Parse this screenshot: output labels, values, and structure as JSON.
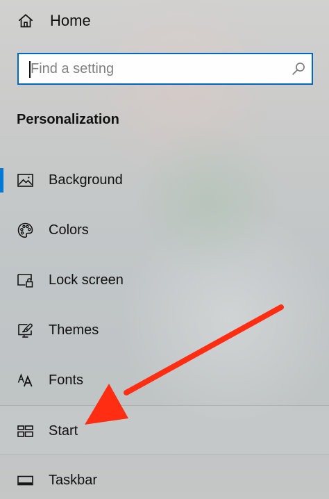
{
  "home": {
    "label": "Home",
    "icon": "home-icon"
  },
  "search": {
    "placeholder": "Find a setting",
    "value": "",
    "icon": "search-icon",
    "border_color": "#0067c0"
  },
  "section": {
    "title": "Personalization"
  },
  "nav": {
    "selected": "Background",
    "accent_color": "#0078d7",
    "items": [
      {
        "label": "Background",
        "icon": "background-icon"
      },
      {
        "label": "Colors",
        "icon": "palette-icon"
      },
      {
        "label": "Lock screen",
        "icon": "lock-screen-icon"
      },
      {
        "label": "Themes",
        "icon": "themes-icon"
      },
      {
        "label": "Fonts",
        "icon": "fonts-icon"
      },
      {
        "label": "Start",
        "icon": "start-icon"
      },
      {
        "label": "Taskbar",
        "icon": "taskbar-icon"
      }
    ]
  },
  "annotation": {
    "arrow_color": "#ff2d12",
    "target": "Start"
  }
}
